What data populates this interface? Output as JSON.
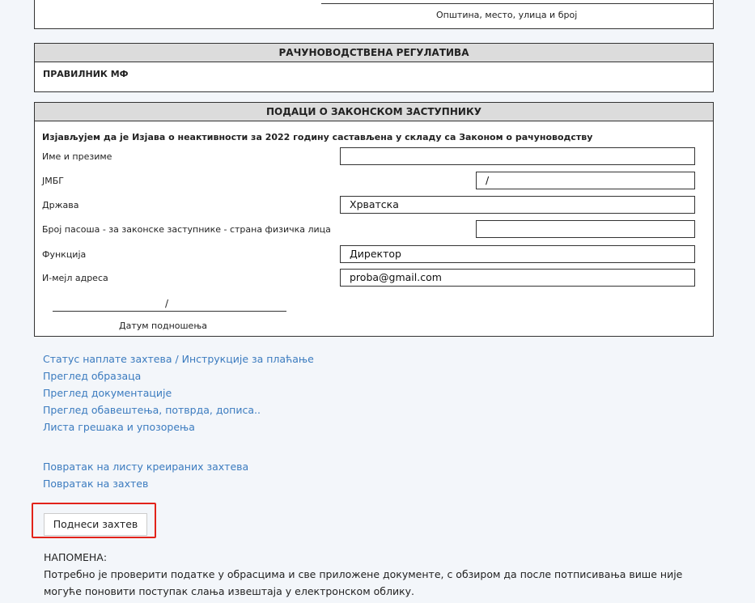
{
  "top": {
    "caption": "Општина, место, улица и број"
  },
  "regulation": {
    "header": "РАЧУНОВОДСТВЕНА РЕГУЛАТИВА",
    "value": "ПРАВИЛНИК МФ"
  },
  "representative": {
    "header": "ПОДАЦИ О ЗАКОНСКОМ ЗАСТУПНИКУ",
    "intro": "Изјављујем да је Изјава о неактивности за 2022 годину састављена у складу са Законом о рачуноводству",
    "fields": {
      "name": {
        "label": "Име и презиме",
        "value": ""
      },
      "jmbg": {
        "label": "ЈМБГ",
        "value": "/"
      },
      "country": {
        "label": "Држава",
        "value": "Хрватска"
      },
      "passport": {
        "label": "Број пасоша - за законске заступнике - страна физичка лица",
        "value": ""
      },
      "function": {
        "label": "Функција",
        "value": "Директор"
      },
      "email": {
        "label": "И-мејл адреса",
        "value": "proba@gmail.com"
      }
    },
    "date_slash": "/",
    "date_caption": "Датум подношења"
  },
  "links": {
    "group1": [
      "Статус наплате захтева / Инструкције за плаћање",
      "Преглед образаца",
      "Преглед документације",
      "Преглед обавештења, потврда, дописа..",
      "Листа грешака и упозорења"
    ],
    "group2": [
      "Повратак на листу креираних захтева",
      "Повратак на захтев"
    ]
  },
  "submit_label": "Поднеси захтев",
  "note": {
    "title": "НАПОМЕНА:",
    "text": "Потребно је проверити податке у обрасцима и све приложене документе, с обзиром да после потписивања више није могуће поновити поступак слања извештаја у електронском облику."
  },
  "colors": {
    "link": "#3b7bbf",
    "highlight": "#e2231a",
    "header_bg": "#dcdcdc"
  }
}
